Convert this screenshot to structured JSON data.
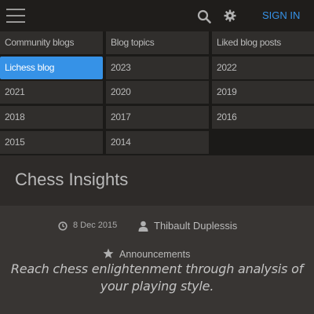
{
  "topbar": {
    "icons": [
      "hamburger-menu-icon",
      "search-icon",
      "gear-icon"
    ],
    "signin_label": "SIGN IN",
    "colors": {
      "accent": "#3692e7",
      "bar": "#1f1d1b"
    }
  },
  "menu": {
    "items": [
      {
        "label": "Community blogs",
        "active": false
      },
      {
        "label": "Blog topics",
        "active": false
      },
      {
        "label": "Liked blog posts",
        "active": false
      },
      {
        "label": "Lichess blog",
        "active": true
      },
      {
        "label": "2023",
        "active": false
      },
      {
        "label": "2022",
        "active": false
      },
      {
        "label": "2021",
        "active": false
      },
      {
        "label": "2020",
        "active": false
      },
      {
        "label": "2019",
        "active": false
      },
      {
        "label": "2018",
        "active": false
      },
      {
        "label": "2017",
        "active": false
      },
      {
        "label": "2016",
        "active": false
      },
      {
        "label": "2015",
        "active": false
      },
      {
        "label": "2014",
        "active": false
      }
    ]
  },
  "blog": {
    "title": "Chess Insights"
  },
  "post": {
    "date": "8 Dec 2015",
    "author": "Thibault Duplessis",
    "category": "Announcements",
    "intro": "Reach chess enlightenment through analysis of your playing style.",
    "icons": [
      "clock-icon",
      "user-icon",
      "star-icon"
    ]
  }
}
